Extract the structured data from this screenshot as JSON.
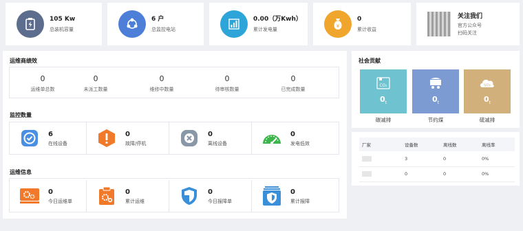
{
  "stats": [
    {
      "value": "105 Kw",
      "label": "总装机容量",
      "icon": "battery-icon",
      "color": "#5c6d8d"
    },
    {
      "value": "6 户",
      "label": "总监控电站",
      "icon": "network-icon",
      "color": "#4d7fd9"
    },
    {
      "value": "0.00（万Kwh）",
      "label": "累计发电量",
      "icon": "chart-icon",
      "color": "#2da5d8"
    },
    {
      "value": "0",
      "label": "累计收益",
      "icon": "money-bag-icon",
      "color": "#f0a52c"
    }
  ],
  "follow": {
    "title": "关注我们",
    "line1": "官方公众号",
    "line2": "扫码关注"
  },
  "performance": {
    "title": "运维商绩效",
    "items": [
      {
        "value": "0",
        "label": "运维单总数"
      },
      {
        "value": "0",
        "label": "未派工数量"
      },
      {
        "value": "0",
        "label": "维修中数量"
      },
      {
        "value": "0",
        "label": "待审核数量"
      },
      {
        "value": "0",
        "label": "已完成数量"
      }
    ]
  },
  "monitor": {
    "title": "监控数量",
    "items": [
      {
        "value": "6",
        "label": "在线设备",
        "icon": "check-badge-icon",
        "color": "#4a90e2"
      },
      {
        "value": "0",
        "label": "故障/停机",
        "icon": "warning-icon",
        "color": "#f07a2a"
      },
      {
        "value": "0",
        "label": "离线设备",
        "icon": "offline-icon",
        "color": "#8a97a6"
      },
      {
        "value": "0",
        "label": "发电低效",
        "icon": "gauge-icon",
        "color": "#3cb64a"
      }
    ]
  },
  "ops": {
    "title": "运维信息",
    "items": [
      {
        "value": "0",
        "label": "今日运维单",
        "icon": "gears-icon",
        "color": "#f07a2a"
      },
      {
        "value": "0",
        "label": "累计运维",
        "icon": "clipboard-gear-icon",
        "color": "#f07a2a"
      },
      {
        "value": "0",
        "label": "今日报障单",
        "icon": "shield-icon",
        "color": "#3b8fd9"
      },
      {
        "value": "0",
        "label": "累计报障",
        "icon": "shield-stack-icon",
        "color": "#3b8fd9"
      }
    ]
  },
  "social": {
    "title": "社会贡献",
    "items": [
      {
        "value": "0",
        "unit": "t",
        "label": "碳减排",
        "badge": "CO₂",
        "color": "#6fc3d0"
      },
      {
        "value": "0",
        "unit": "t",
        "label": "节约煤",
        "badge": "",
        "color": "#7b9bd2"
      },
      {
        "value": "0",
        "unit": "t",
        "label": "硫减排",
        "badge": "SO₂",
        "color": "#d2b07c"
      }
    ]
  },
  "factory_table": {
    "headers": [
      "厂家",
      "设备数",
      "离线数",
      "离线率"
    ],
    "rows": [
      [
        "",
        "3",
        "0",
        "0%"
      ],
      [
        "",
        "0",
        "0",
        "0%"
      ]
    ]
  }
}
